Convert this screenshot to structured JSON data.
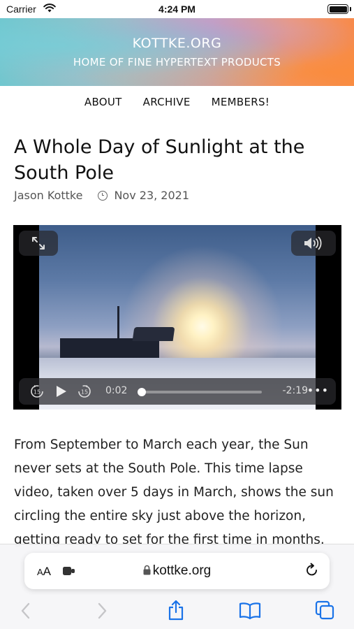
{
  "status_bar": {
    "carrier": "Carrier",
    "time": "4:24 PM",
    "wifi_icon": "wifi-icon",
    "battery_icon": "battery-icon"
  },
  "site": {
    "title": "KOTTKE.ORG",
    "tagline": "HOME OF FINE HYPERTEXT PRODUCTS"
  },
  "nav": {
    "items": [
      "ABOUT",
      "ARCHIVE",
      "MEMBERS!"
    ]
  },
  "article": {
    "title": "A Whole Day of Sunlight at the South Pole",
    "author": "Jason Kottke",
    "date": "Nov 23, 2021",
    "body": "From September to March each year, the Sun never sets at the South Pole. This time lapse video, taken over 5 days in March, shows the sun circling the entire sky just above the horizon, getting ready to set for the first time in months."
  },
  "video": {
    "current_time": "0:02",
    "remaining_time": "-2:19",
    "progress": 0.02,
    "more_label": "•••",
    "icons": [
      "expand-icon",
      "volume-icon",
      "skip-back-15-icon",
      "play-icon",
      "skip-forward-15-icon",
      "more-icon"
    ]
  },
  "browser": {
    "aa_label_big": "A",
    "aa_label_small": "A",
    "url": "kottke.org",
    "icons": [
      "extension-icon",
      "lock-icon",
      "reload-icon",
      "back-icon",
      "forward-icon",
      "share-icon",
      "bookmarks-icon",
      "tabs-icon"
    ]
  }
}
